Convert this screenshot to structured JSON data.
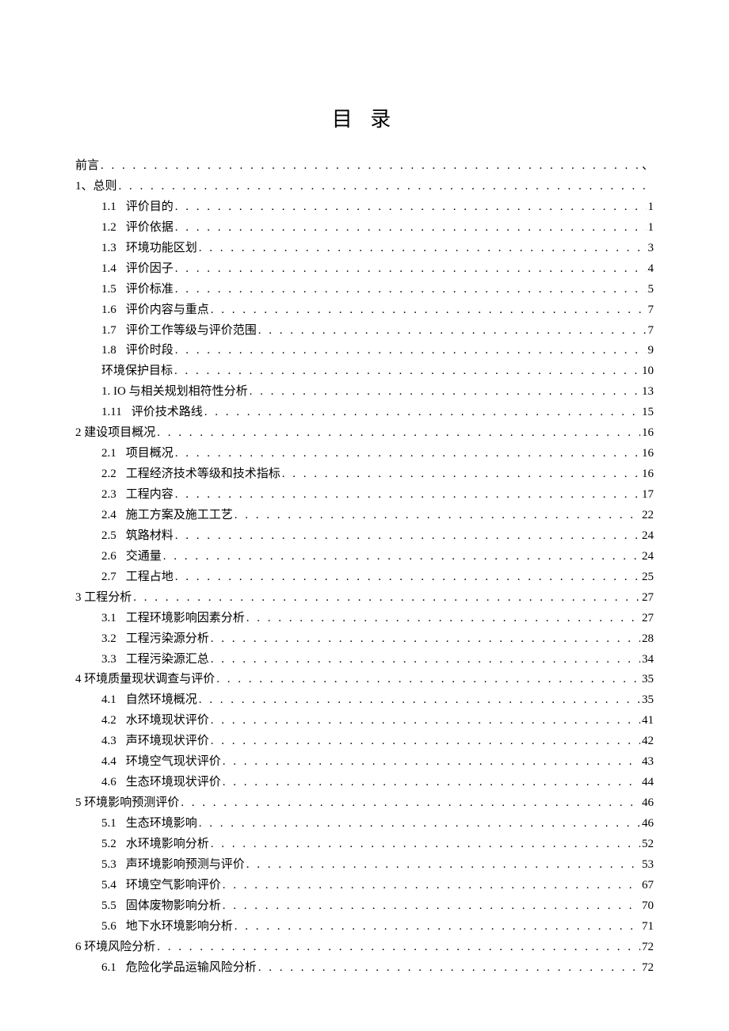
{
  "title": "目 录",
  "entries": [
    {
      "level": 1,
      "num": "",
      "label": "前言",
      "page": "、"
    },
    {
      "level": 1,
      "num": "",
      "label": "1、总则",
      "page": ""
    },
    {
      "level": 2,
      "num": "1.1",
      "label": "评价目的",
      "page": "1"
    },
    {
      "level": 2,
      "num": "1.2",
      "label": "评价依据",
      "page": "1"
    },
    {
      "level": 2,
      "num": "1.3",
      "label": "环境功能区划",
      "page": "3"
    },
    {
      "level": 2,
      "num": "1.4",
      "label": "评价因子",
      "page": "4"
    },
    {
      "level": 2,
      "num": "1.5",
      "label": "评价标准",
      "page": "5"
    },
    {
      "level": 2,
      "num": "1.6",
      "label": "评价内容与重点",
      "page": "7"
    },
    {
      "level": 2,
      "num": "1.7",
      "label": "评价工作等级与评价范围",
      "page": "7"
    },
    {
      "level": 2,
      "num": "1.8",
      "label": "评价时段",
      "page": "9"
    },
    {
      "level": 2,
      "num": "",
      "label": "环境保护目标",
      "page": "10"
    },
    {
      "level": 2,
      "num": "",
      "label": "1. IO 与相关规划相符性分析",
      "page": "13"
    },
    {
      "level": 2,
      "num": "1.11",
      "label": " 评价技术路线",
      "page": "15"
    },
    {
      "level": 1,
      "num": "",
      "label": "2 建设项目概况",
      "page": "16"
    },
    {
      "level": 2,
      "num": "2.1",
      "label": " 项目概况",
      "page": "16"
    },
    {
      "level": 2,
      "num": "2.2",
      "label": "工程经济技术等级和技术指标",
      "page": "16"
    },
    {
      "level": 2,
      "num": "2.3",
      "label": "工程内容",
      "page": "17"
    },
    {
      "level": 2,
      "num": "2.4",
      "label": "施工方案及施工工艺",
      "page": "22"
    },
    {
      "level": 2,
      "num": "2.5",
      "label": "筑路材料",
      "page": "24"
    },
    {
      "level": 2,
      "num": "2.6",
      "label": "交通量",
      "page": "24"
    },
    {
      "level": 2,
      "num": "2.7",
      "label": "工程占地",
      "page": "25"
    },
    {
      "level": 1,
      "num": "",
      "label": "3 工程分析",
      "page": "27"
    },
    {
      "level": 2,
      "num": "3.1",
      "label": "工程环境影响因素分析",
      "page": "27"
    },
    {
      "level": 2,
      "num": "3.2",
      "label": "工程污染源分析",
      "page": "28"
    },
    {
      "level": 2,
      "num": "3.3",
      "label": "工程污染源汇总",
      "page": "34"
    },
    {
      "level": 1,
      "num": "",
      "label": "4 环境质量现状调查与评价",
      "page": "35"
    },
    {
      "level": 2,
      "num": "4.1",
      "label": "自然环境概况",
      "page": "35"
    },
    {
      "level": 2,
      "num": "4.2",
      "label": "水环境现状评价",
      "page": "41"
    },
    {
      "level": 2,
      "num": "4.3",
      "label": "声环境现状评价",
      "page": "42"
    },
    {
      "level": 2,
      "num": "4.4",
      "label": "环境空气现状评价",
      "page": "43"
    },
    {
      "level": 2,
      "num": "4.6",
      "label": "生态环境现状评价",
      "page": "44"
    },
    {
      "level": 1,
      "num": "",
      "label": "5 环境影响预测评价",
      "page": "46"
    },
    {
      "level": 2,
      "num": "5.1",
      "label": "生态环境影响",
      "page": "46"
    },
    {
      "level": 2,
      "num": "5.2",
      "label": "水环境影响分析",
      "page": "52"
    },
    {
      "level": 2,
      "num": "5.3",
      "label": "声环境影响预测与评价",
      "page": "53"
    },
    {
      "level": 2,
      "num": "5.4",
      "label": "环境空气影响评价",
      "page": "67"
    },
    {
      "level": 2,
      "num": "5.5",
      "label": "固体废物影响分析",
      "page": "70"
    },
    {
      "level": 2,
      "num": "5.6",
      "label": "地下水环境影响分析",
      "page": "71"
    },
    {
      "level": 1,
      "num": "",
      "label": "6 环境风险分析",
      "page": "72"
    },
    {
      "level": 2,
      "num": "6.1",
      "label": "危险化学品运输风险分析",
      "page": "72"
    }
  ]
}
